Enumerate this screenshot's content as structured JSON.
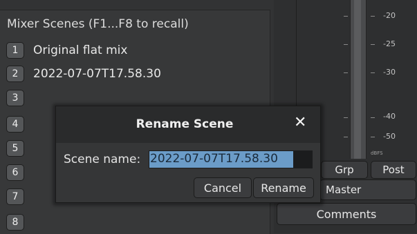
{
  "scenes_panel": {
    "title": "Mixer Scenes (F1...F8 to recall)",
    "scenes": [
      {
        "number": "1",
        "name": "Original flat mix"
      },
      {
        "number": "2",
        "name": "2022-07-07T17.58.30"
      },
      {
        "number": "3",
        "name": ""
      },
      {
        "number": "4",
        "name": ""
      },
      {
        "number": "5",
        "name": ""
      },
      {
        "number": "6",
        "name": ""
      },
      {
        "number": "7",
        "name": ""
      },
      {
        "number": "8",
        "name": ""
      }
    ]
  },
  "meter": {
    "scale": [
      "-20",
      "-25",
      "-30",
      "-40",
      "-50"
    ],
    "unit": "dBFS"
  },
  "strip": {
    "grp_label": "Grp",
    "post_label": "Post",
    "master_label": "Master",
    "comments_label": "Comments"
  },
  "dialog": {
    "title": "Rename Scene",
    "close_glyph": "✕",
    "field_label": "Scene name:",
    "field_value": "2022-07-07T17.58.30",
    "cancel_label": "Cancel",
    "rename_label": "Rename"
  }
}
